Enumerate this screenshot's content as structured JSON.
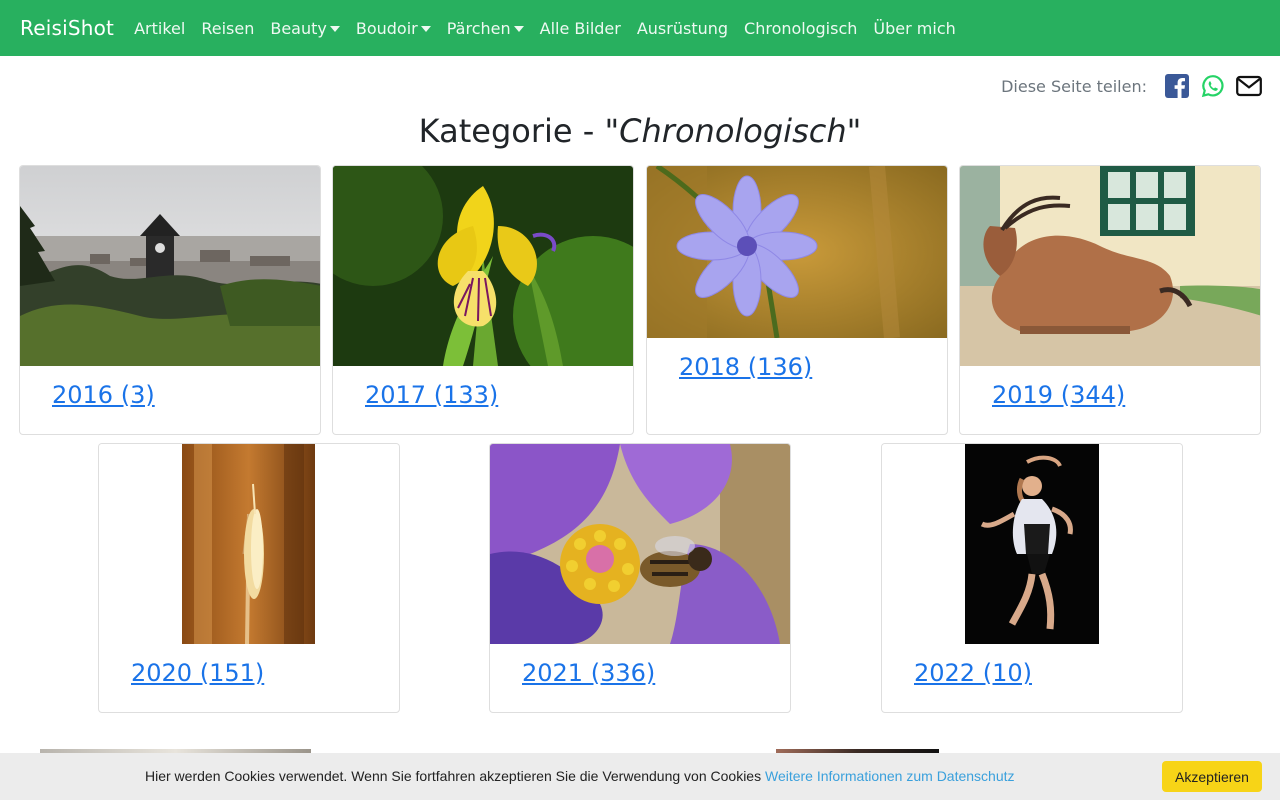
{
  "nav": {
    "brand": "ReisiShot",
    "items": [
      {
        "label": "Artikel",
        "dropdown": false
      },
      {
        "label": "Reisen",
        "dropdown": false
      },
      {
        "label": "Beauty",
        "dropdown": true
      },
      {
        "label": "Boudoir",
        "dropdown": true
      },
      {
        "label": "Pärchen",
        "dropdown": true
      },
      {
        "label": "Alle Bilder",
        "dropdown": false
      },
      {
        "label": "Ausrüstung",
        "dropdown": false
      },
      {
        "label": "Chronologisch",
        "dropdown": false
      },
      {
        "label": "Über mich",
        "dropdown": false
      }
    ]
  },
  "share": {
    "label": "Diese Seite teilen:",
    "icons": [
      "facebook-icon",
      "whatsapp-icon",
      "email-icon"
    ]
  },
  "page": {
    "title_prefix": "Kategorie - ",
    "title_quoted": "\"Chronologisch\""
  },
  "cards": [
    {
      "label": "2016 (3)",
      "image": "city-clock-tower-photo"
    },
    {
      "label": "2017 (133)",
      "image": "yellow-iris-photo"
    },
    {
      "label": "2018 (136)",
      "image": "chicory-flower-photo"
    },
    {
      "label": "2019 (344)",
      "image": "eland-antelope-photo"
    },
    {
      "label": "2020 (151)",
      "image": "grass-seedhead-photo"
    },
    {
      "label": "2021 (336)",
      "image": "bee-on-pasqueflower-photo"
    },
    {
      "label": "2022 (10)",
      "image": "dancer-portrait-photo"
    }
  ],
  "cookie": {
    "text": "Hier werden Cookies verwendet. Wenn Sie fortfahren akzeptieren Sie die Verwendung von Cookies ",
    "link": "Weitere Informationen zum Datenschutz",
    "button": "Akzeptieren"
  },
  "colors": {
    "navbar": "#28b05f",
    "link": "#1a73e8",
    "cookie_button": "#f7d417",
    "facebook": "#3b5998",
    "whatsapp": "#25d366"
  }
}
